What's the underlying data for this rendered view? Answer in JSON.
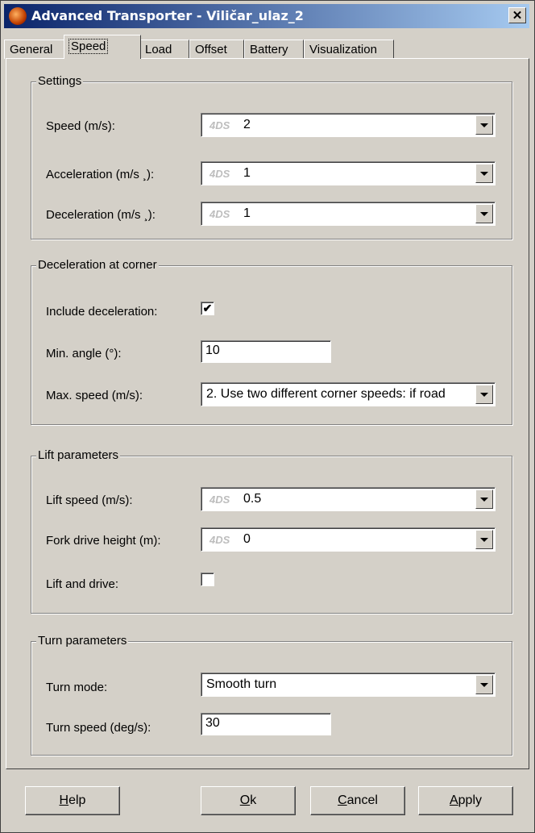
{
  "window": {
    "title": "Advanced Transporter - Viličar_ulaz_2",
    "close_glyph": "✕"
  },
  "tabs": [
    {
      "label": "General"
    },
    {
      "label": "Speed"
    },
    {
      "label": "Load"
    },
    {
      "label": "Offset"
    },
    {
      "label": "Battery"
    },
    {
      "label": "Visualization"
    }
  ],
  "active_tab": "Speed",
  "settings": {
    "legend": "Settings",
    "speed_label": "Speed (m/s):",
    "speed_tag": "4DS",
    "speed_value": "2",
    "accel_label": "Acceleration (m/s ¸):",
    "accel_tag": "4DS",
    "accel_value": "1",
    "decel_label": "Deceleration (m/s ¸):",
    "decel_tag": "4DS",
    "decel_value": "1"
  },
  "corner": {
    "legend": "Deceleration at corner",
    "include_label": "Include deceleration:",
    "include_checked": "✔",
    "min_angle_label": "Min. angle (°):",
    "min_angle_value": "10",
    "max_speed_label": "Max. speed (m/s):",
    "max_speed_value": "2. Use two different corner speeds: if road"
  },
  "lift": {
    "legend": "Lift parameters",
    "lift_speed_label": "Lift speed (m/s):",
    "lift_speed_tag": "4DS",
    "lift_speed_value": "0.5",
    "fork_label": "Fork drive height (m):",
    "fork_tag": "4DS",
    "fork_value": "0",
    "lift_drive_label": "Lift and drive:",
    "lift_drive_checked": ""
  },
  "turn": {
    "legend": "Turn parameters",
    "mode_label": "Turn mode:",
    "mode_value": "Smooth turn",
    "speed_label": "Turn speed (deg/s):",
    "speed_value": "30"
  },
  "buttons": {
    "help_u": "H",
    "help_rest": "elp",
    "ok_u": "O",
    "ok_rest": "k",
    "cancel_u": "C",
    "cancel_rest": "ancel",
    "apply_u": "A",
    "apply_rest": "pply"
  }
}
